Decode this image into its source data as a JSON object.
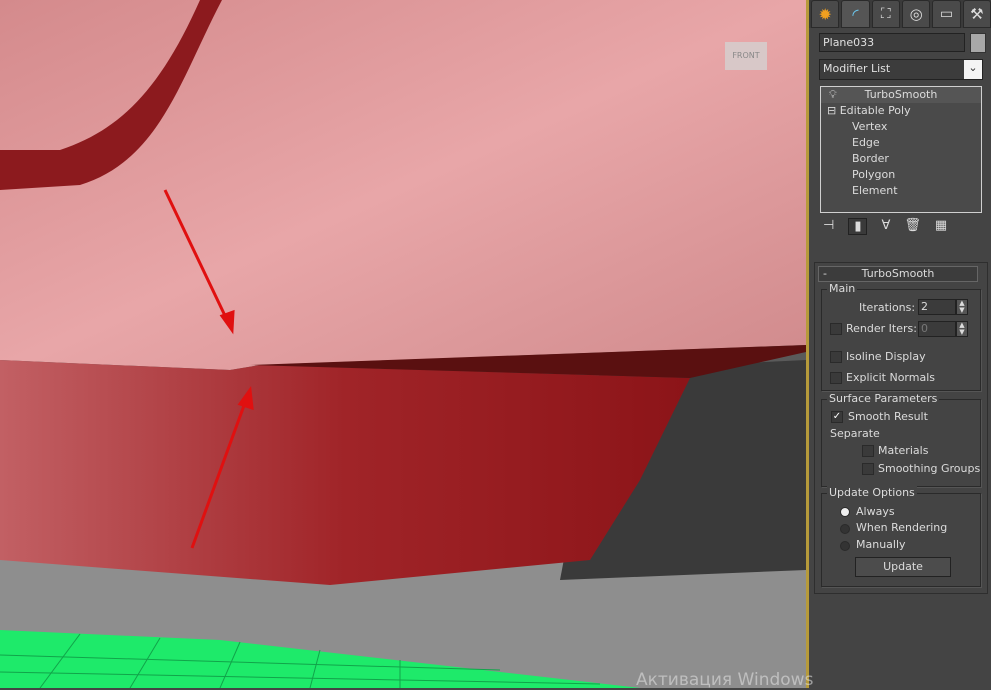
{
  "object_name": "Plane033",
  "modifier_list": "Modifier List",
  "stack": {
    "top": "TurboSmooth",
    "base": "Editable Poly",
    "subs": [
      "Vertex",
      "Edge",
      "Border",
      "Polygon",
      "Element"
    ]
  },
  "rollout": {
    "title": "TurboSmooth",
    "collapse": "-",
    "main": {
      "label": "Main",
      "iterations_label": "Iterations:",
      "iterations": "2",
      "render_iters_label": "Render Iters:",
      "render_iters": "0",
      "isoline": "Isoline Display",
      "explicit": "Explicit Normals"
    },
    "surface": {
      "label": "Surface Parameters",
      "smooth": "Smooth Result",
      "separate": "Separate",
      "materials": "Materials",
      "smoothing": "Smoothing Groups"
    },
    "update": {
      "label": "Update Options",
      "always": "Always",
      "when": "When Rendering",
      "manually": "Manually",
      "button": "Update"
    }
  },
  "viewcube": "FRONT",
  "watermark": "Активация Windows",
  "colors": {
    "body": "#c2686a",
    "annotation": "#e01010",
    "grid": "#1eea6a"
  }
}
